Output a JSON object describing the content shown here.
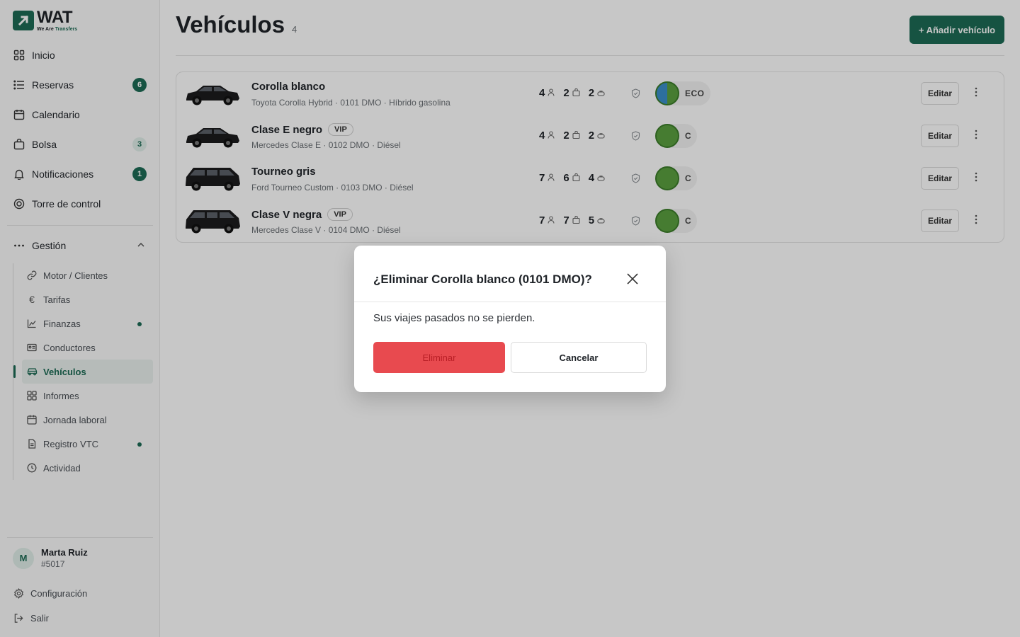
{
  "brand": {
    "name": "WAT",
    "tag_a": "We Are",
    "tag_b": "Transfers"
  },
  "sidebar": {
    "items": [
      {
        "label": "Inicio",
        "icon": "grid-icon"
      },
      {
        "label": "Reservas",
        "icon": "list-icon",
        "badge": "6"
      },
      {
        "label": "Calendario",
        "icon": "calendar-icon"
      },
      {
        "label": "Bolsa",
        "icon": "bag-icon",
        "badge": "3"
      },
      {
        "label": "Notificaciones",
        "icon": "bell-icon",
        "badge": "1"
      },
      {
        "label": "Torre de control",
        "icon": "target-icon"
      }
    ],
    "group": {
      "label": "Gestión",
      "icon": "dots-icon",
      "expanded": true
    },
    "subitems": [
      {
        "label": "Motor / Clientes",
        "icon": "link-icon"
      },
      {
        "label": "Tarifas",
        "icon": "euro-icon"
      },
      {
        "label": "Finanzas",
        "icon": "chart-icon",
        "dot": true
      },
      {
        "label": "Conductores",
        "icon": "id-card-icon"
      },
      {
        "label": "Vehículos",
        "icon": "car-icon",
        "active": true
      },
      {
        "label": "Informes",
        "icon": "grid-icon"
      },
      {
        "label": "Jornada laboral",
        "icon": "calendar-icon"
      },
      {
        "label": "Registro VTC",
        "icon": "document-icon",
        "dot": true
      },
      {
        "label": "Actividad",
        "icon": "clock-icon"
      }
    ],
    "user": {
      "initial": "M",
      "name": "Marta Ruiz",
      "id": "#5017"
    },
    "footer": {
      "settings": "Configuración",
      "logout": "Salir"
    }
  },
  "main": {
    "title": "Vehículos",
    "count": "4",
    "add_button": "+ Añadir vehículo",
    "vehicles": [
      {
        "name": "Corolla blanco",
        "vip": "",
        "sub": "Toyota Corolla Hybrid · 0101 DMO · Híbrido gasolina",
        "seats": "4",
        "bags": "2",
        "small_bags": "2",
        "label": "ECO",
        "type": "sedan"
      },
      {
        "name": "Clase E negro",
        "vip": "VIP",
        "sub": "Mercedes Clase E · 0102 DMO · Diésel",
        "seats": "4",
        "bags": "2",
        "small_bags": "2",
        "label": "C",
        "type": "sedan"
      },
      {
        "name": "Tourneo gris",
        "vip": "",
        "sub": "Ford Tourneo Custom · 0103 DMO · Diésel",
        "seats": "7",
        "bags": "6",
        "small_bags": "4",
        "label": "C",
        "type": "van"
      },
      {
        "name": "Clase V negra",
        "vip": "VIP",
        "sub": "Mercedes Clase V · 0104 DMO · Diésel",
        "seats": "7",
        "bags": "7",
        "small_bags": "5",
        "label": "C",
        "type": "van"
      }
    ],
    "edit_label": "Editar"
  },
  "modal": {
    "title": "¿Eliminar Corolla blanco (0101 DMO)?",
    "body": "Sus viajes pasados no se pierden.",
    "delete": "Eliminar",
    "cancel": "Cancelar"
  },
  "colors": {
    "brand": "#1d6b55",
    "danger": "#e84a4f"
  }
}
